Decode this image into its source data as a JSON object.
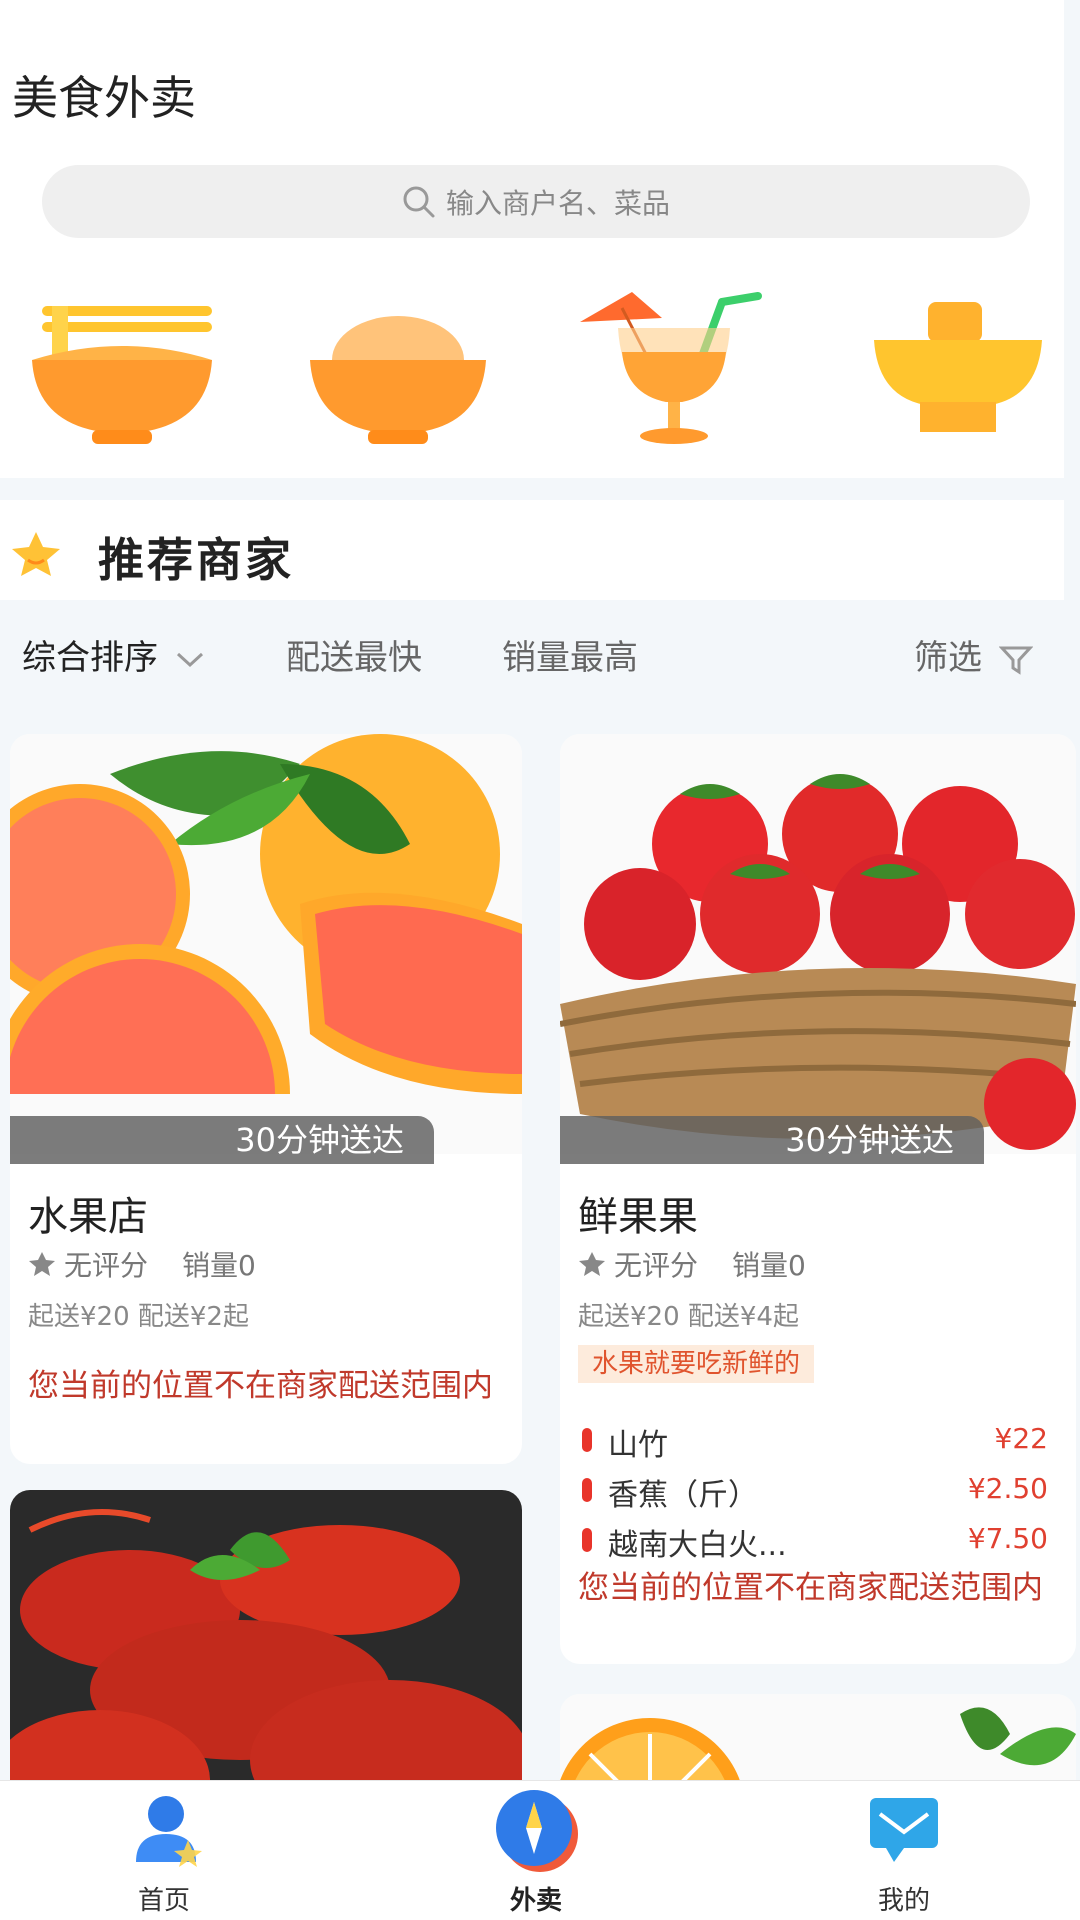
{
  "header": {
    "title": "美食外卖"
  },
  "search": {
    "placeholder": "输入商户名、菜品"
  },
  "categories": [
    {
      "icon": "noodle-bowl-icon"
    },
    {
      "icon": "rice-bowl-icon"
    },
    {
      "icon": "juice-drink-icon"
    },
    {
      "icon": "dessert-cup-icon"
    }
  ],
  "recommend": {
    "title": "推荐商家"
  },
  "sort": {
    "comprehensive": "综合排序",
    "fastest": "配送最快",
    "top_sales": "销量最高",
    "filter": "筛选"
  },
  "shops": [
    {
      "ribbon": "30分钟送达",
      "name": "水果店",
      "rating": "无评分",
      "sales": "销量0",
      "fee": "起送¥20 配送¥2起",
      "warning": "您当前的位置不在商家配送范围内"
    },
    {
      "ribbon": "30分钟送达",
      "name": "鲜果果",
      "rating": "无评分",
      "sales": "销量0",
      "fee": "起送¥20 配送¥4起",
      "slogan": "水果就要吃新鲜的",
      "items": [
        {
          "name": "山竹",
          "price": "¥22"
        },
        {
          "name": "香蕉（斤）",
          "price": "¥2.50"
        },
        {
          "name": "越南大白火...",
          "price": "¥7.50"
        }
      ],
      "warning": "您当前的位置不在商家配送范围内"
    }
  ],
  "tabs": {
    "home": "首页",
    "takeout": "外卖",
    "mine": "我的"
  },
  "colors": {
    "accent": "#e04030",
    "warn": "#c0392b",
    "ribbon": "#5f5f5f"
  }
}
